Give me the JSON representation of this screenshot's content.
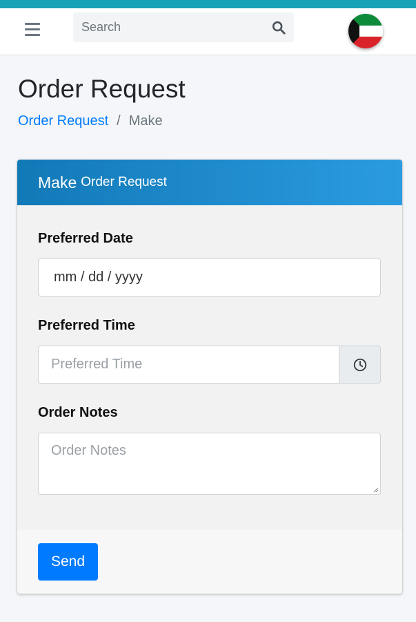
{
  "colors": {
    "top_strip": "#17a2b8",
    "header_gradient_start": "#1279b7",
    "header_gradient_end": "#2b9be0",
    "primary": "#007bff"
  },
  "navbar": {
    "menu_icon": "hamburger-menu-icon",
    "search": {
      "placeholder": "Search",
      "icon": "search-icon"
    },
    "language_flag": "kuwait-flag-icon"
  },
  "page": {
    "title": "Order Request",
    "breadcrumb": {
      "link": "Order Request",
      "separator": "/",
      "current": "Make"
    }
  },
  "card": {
    "header_big": "Make",
    "header_small": "Order Request",
    "fields": {
      "date": {
        "label": "Preferred Date",
        "value": "mm / dd / yyyy"
      },
      "time": {
        "label": "Preferred Time",
        "placeholder": "Preferred Time",
        "icon": "clock-icon"
      },
      "notes": {
        "label": "Order Notes",
        "placeholder": "Order Notes"
      }
    },
    "submit_label": "Send"
  }
}
